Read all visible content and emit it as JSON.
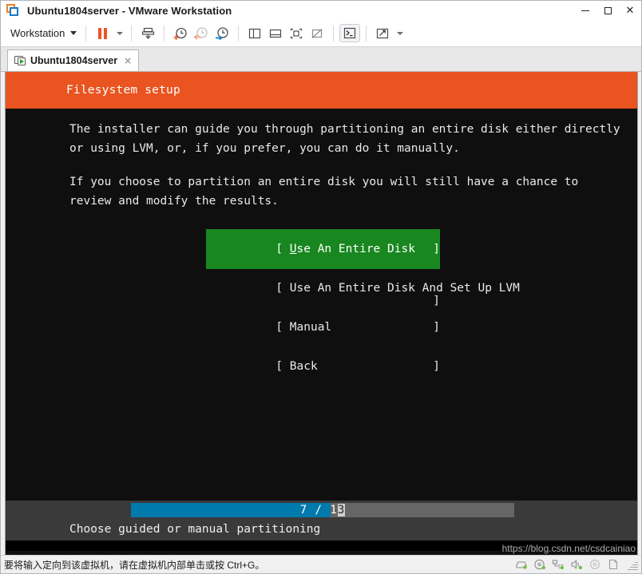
{
  "window": {
    "title": "Ubuntu1804server - VMware Workstation",
    "app_icon": "vmware-logo-icon",
    "minimize_label": "Minimize",
    "maximize_label": "Maximize",
    "close_label": "Close"
  },
  "toolbar": {
    "menu_label": "Workstation",
    "buttons": [
      {
        "name": "pause-vm-button",
        "icon": "pause-icon",
        "tooltip": "Suspend this virtual machine"
      },
      {
        "name": "power-dropdown-button",
        "icon": "chevron-down-icon",
        "tooltip": "Power options"
      },
      {
        "name": "manage-snapshot-button",
        "icon": "snapshot-icon",
        "tooltip": "Manage snapshots"
      },
      {
        "name": "take-snapshot-button",
        "icon": "clock-plus-icon",
        "tooltip": "Take a snapshot of this virtual machine"
      },
      {
        "name": "revert-snapshot-button",
        "icon": "clock-back-icon",
        "tooltip": "Revert to snapshot"
      },
      {
        "name": "snapshot-manager-button",
        "icon": "clock-wrench-icon",
        "tooltip": "Snapshot manager"
      },
      {
        "name": "show-sidebar-button",
        "icon": "panel-left-icon",
        "tooltip": "Show or hide the library"
      },
      {
        "name": "show-console-view-button",
        "icon": "panel-bottom-icon",
        "tooltip": "Show or hide the console view"
      },
      {
        "name": "show-thumbnail-bar-button",
        "icon": "thumbnail-bar-icon",
        "tooltip": "Show or hide thumbnail bar"
      },
      {
        "name": "hide-thumbnail-bar-button",
        "icon": "thumbnail-bar-off-icon",
        "tooltip": "Hide thumbnail bar"
      },
      {
        "name": "console-terminal-button",
        "icon": "terminal-prompt-icon",
        "tooltip": "Send Ctrl+Alt+Del"
      },
      {
        "name": "fullscreen-button",
        "icon": "expand-arrows-icon",
        "tooltip": "Enter full screen mode"
      },
      {
        "name": "fullscreen-dropdown-button",
        "icon": "chevron-down-icon",
        "tooltip": "Full screen options"
      }
    ]
  },
  "tab": {
    "label": "Ubuntu1804server",
    "icon": "vm-running-icon",
    "close_label": "×"
  },
  "installer": {
    "header_title": "Filesystem setup",
    "header_color": "#e95420",
    "paragraphs": [
      "The installer can guide you through partitioning an entire disk either directly\nor using LVM, or, if you prefer, you can do it manually.",
      "If you choose to partition an entire disk you will still have a chance to\nreview and modify the results."
    ],
    "menu": {
      "selected_index": 0,
      "highlight_color": "#18871f",
      "items": [
        {
          "accel": "U",
          "rest": "se An Entire Disk",
          "full": "Use An Entire Disk"
        },
        {
          "accel": "",
          "rest": "Use An Entire Disk And Set Up LVM",
          "full": "Use An Entire Disk And Set Up LVM"
        },
        {
          "accel": "",
          "rest": "Manual",
          "full": "Manual"
        },
        {
          "accel": "",
          "rest": "Back",
          "full": "Back"
        }
      ]
    },
    "progress": {
      "current": "7",
      "total": "13",
      "separator": "/",
      "label_prefix": "7 / 1",
      "label_cursor": "3",
      "percent": 52,
      "fill_color": "#0079ad",
      "track_color": "#666666"
    },
    "footer_hint": "Choose guided or manual partitioning"
  },
  "watermark": "https://blog.csdn.net/csdcainiao",
  "statusbar": {
    "message": "要将输入定向到该虚拟机，请在虚拟机内部单击或按 Ctrl+G。",
    "devices": [
      {
        "name": "hard-disk-icon",
        "active": true
      },
      {
        "name": "cd-dvd-icon",
        "active": true
      },
      {
        "name": "network-adapter-icon",
        "active": true
      },
      {
        "name": "sound-card-icon",
        "active": true
      },
      {
        "name": "usb-device-icon",
        "active": false
      },
      {
        "name": "printer-icon",
        "active": false
      }
    ]
  }
}
